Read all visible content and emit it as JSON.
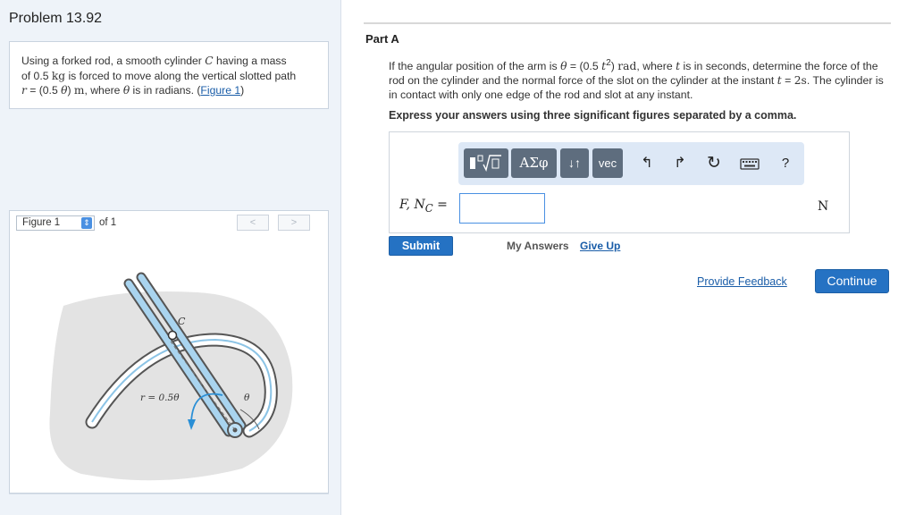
{
  "problem": {
    "title": "Problem 13.92",
    "text_1": "Using a forked rod, a smooth cylinder ",
    "c_symbol": "C",
    "text_2": " having a mass",
    "text_3": "of 0.5 ",
    "kg_unit": "kg",
    "text_4": " is forced to move along the vertical slotted path",
    "r_symbol": "r",
    "text_5": " = (0.5 ",
    "theta_symbol": "θ",
    "text_6": ") ",
    "m_unit": "m",
    "text_7": ", where ",
    "text_8": " is in radians. (",
    "figure_link": "Figure 1",
    "text_9": ")"
  },
  "figure": {
    "selected": "Figure 1",
    "of_text": "of 1",
    "prev_glyph": "<",
    "next_glyph": ">",
    "label_c": "C",
    "label_r": "r = 0.5θ",
    "label_theta": "θ"
  },
  "part": {
    "label": "Part A",
    "q1": "If the angular position of the arm is ",
    "theta": "θ",
    "q2": " = (0.5 ",
    "t": "t",
    "sup2": "2",
    "q3": ") ",
    "rad": "rad",
    "q4": ", where ",
    "q5": " is in seconds, determine the force of the rod on the cylinder and the normal force of the slot on the cylinder at the instant ",
    "q6": " = ",
    "t_value": "2s",
    "q7": ". The cylinder is in contact with only one edge of the rod and slot at any instant.",
    "instruction": "Express your answers using three significant figures separated by a comma."
  },
  "toolbar": {
    "greek": "ΑΣφ",
    "arrows": "↓↑",
    "vec": "vec",
    "undo_glyph": "↰",
    "redo_glyph": "↱",
    "reset_glyph": "↻",
    "help": "?"
  },
  "answer": {
    "label_f": "F",
    "label_sep": ", ",
    "label_n": "N",
    "label_sub": "C",
    "label_eq": " =",
    "value": "",
    "unit": "N"
  },
  "actions": {
    "submit": "Submit",
    "my_answers": "My Answers",
    "give_up": "Give Up",
    "feedback": "Provide Feedback",
    "continue": "Continue"
  }
}
